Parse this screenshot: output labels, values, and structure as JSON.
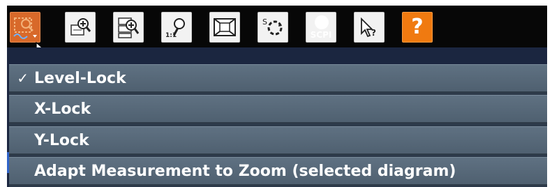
{
  "toolbar": {
    "buttons": [
      {
        "icon": "zoom-mode-icon",
        "active": true
      },
      {
        "icon": "zoom-in-icon"
      },
      {
        "icon": "multi-zoom-icon"
      },
      {
        "icon": "zoom-reset-icon",
        "label": "1:1"
      },
      {
        "icon": "full-screen-icon"
      },
      {
        "icon": "sequencer-icon",
        "label": "S"
      },
      {
        "icon": "scpi-icon",
        "label": "SCPI"
      },
      {
        "icon": "context-help-icon",
        "label": "?"
      },
      {
        "icon": "help-icon",
        "label": "?"
      }
    ]
  },
  "menu": {
    "items": [
      {
        "label": "Level-Lock",
        "check": "✓",
        "checked": true
      },
      {
        "label": "X-Lock",
        "check": ""
      },
      {
        "label": "Y-Lock",
        "check": ""
      },
      {
        "label": "Adapt Measurement to Zoom (selected diagram)",
        "check": ""
      }
    ]
  },
  "colors": {
    "active_button": "#d8692a",
    "help_button": "#f07a10",
    "menu_item": "#56687a",
    "menu_text": "#ffffff"
  }
}
